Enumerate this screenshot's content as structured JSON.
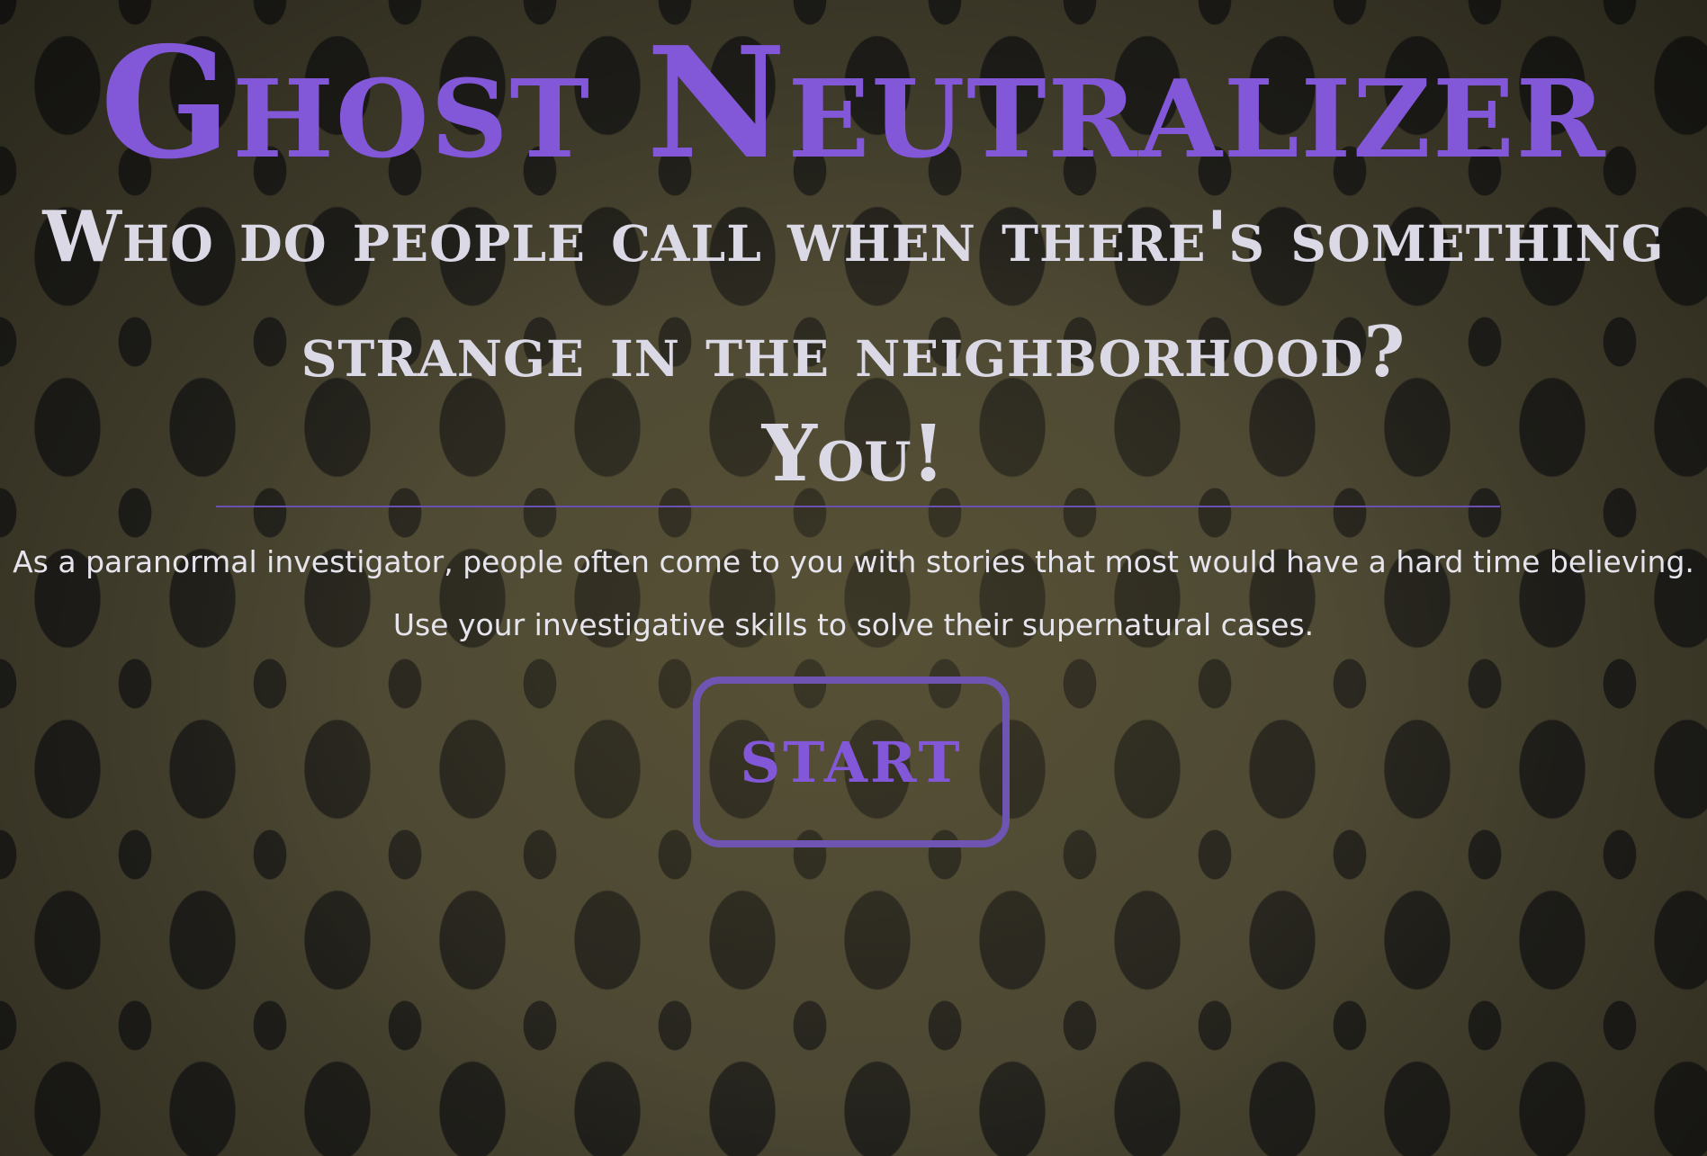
{
  "title": "Ghost Neutralizer",
  "tagline_line1": "Who do people call when there's something",
  "tagline_line2": "strange in the neighborhood?",
  "tagline_answer": "You!",
  "description_line1": "As a paranormal investigator, people often come to you with stories that most would have a hard time believing.",
  "description_line2": "Use your investigative skills to solve their supernatural cases.",
  "start_button": "START",
  "colors": {
    "accent": "#8257d8",
    "border": "#6f54b2",
    "text": "#dcd9e6"
  }
}
